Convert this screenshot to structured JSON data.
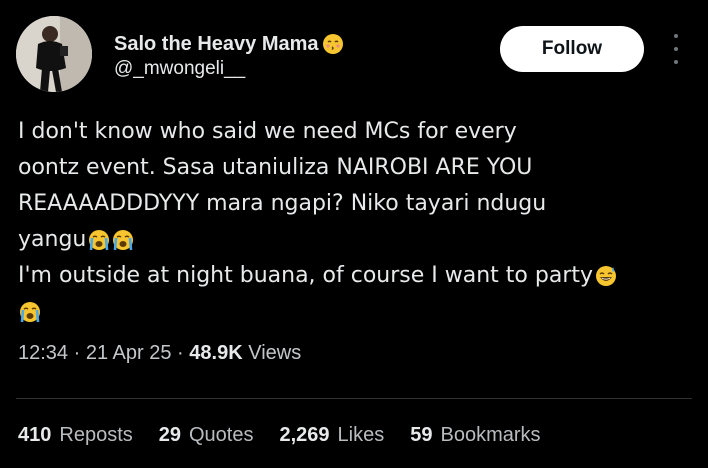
{
  "author": {
    "display_name": "Salo the Heavy Mama",
    "name_emoji": "kissing-face-emoji",
    "handle": "@_mwongeli__"
  },
  "follow_label": "Follow",
  "tweet": {
    "line1": "I don't know who said we need MCs for every",
    "line2": "oontz event. Sasa utaniuliza NAIROBI ARE YOU",
    "line3": "REAAAADDDYYY mara ngapi? Niko tayari ndugu",
    "line4": "yangu",
    "line5": "I'm outside at night buana, of course I want to party",
    "emojis": [
      "loudly-crying-face",
      "loudly-crying-face",
      "grinning-sweat-face",
      "loudly-crying-face"
    ]
  },
  "meta": {
    "time": "12:34",
    "sep1": "·",
    "date": "21 Apr 25",
    "sep2": "·",
    "views_count": "48.9K",
    "views_label": "Views"
  },
  "stats": {
    "reposts_count": "410",
    "reposts_label": "Reposts",
    "quotes_count": "29",
    "quotes_label": "Quotes",
    "likes_count": "2,269",
    "likes_label": "Likes",
    "bookmarks_count": "59",
    "bookmarks_label": "Bookmarks"
  },
  "colors": {
    "background": "#000000",
    "text": "#e7e9ea",
    "secondary": "#71767b",
    "follow_bg": "#ffffff",
    "emoji_yellow": "#f7c52f",
    "tear_blue": "#4aa7e8"
  }
}
